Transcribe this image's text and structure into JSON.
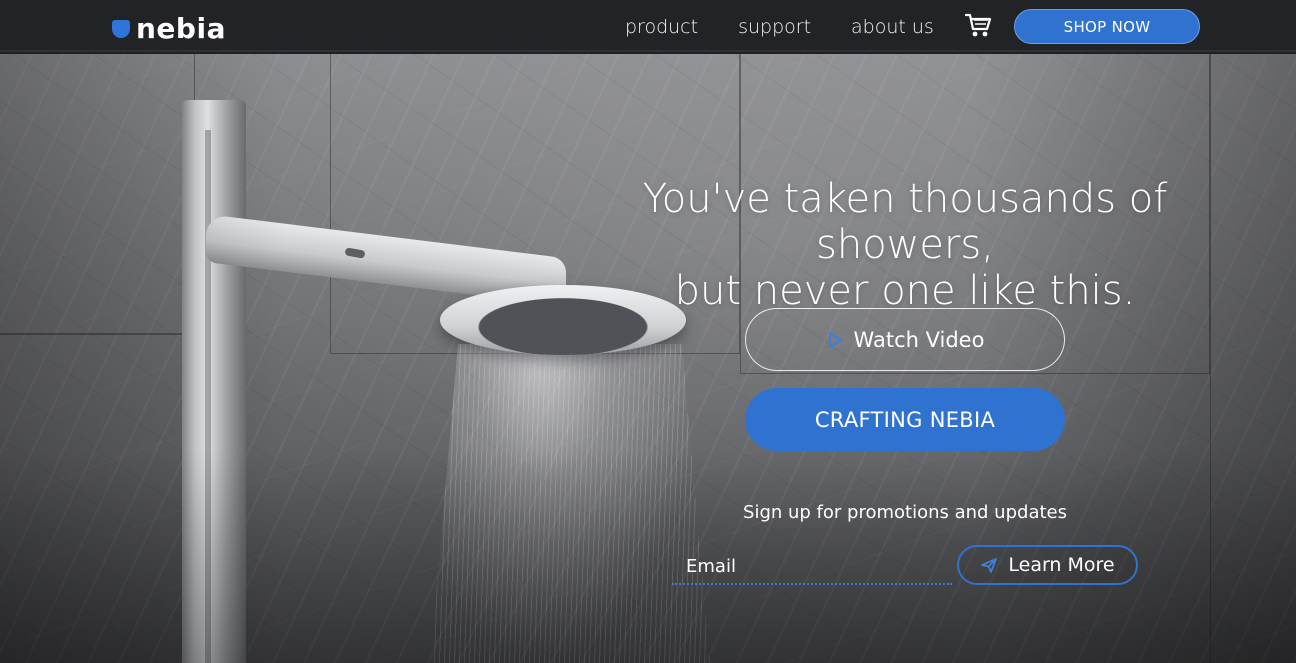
{
  "brand": {
    "name": "nebia",
    "accent": "#2f72cf"
  },
  "nav": {
    "items": [
      {
        "label": "product"
      },
      {
        "label": "support"
      },
      {
        "label": "about us"
      }
    ],
    "cart_icon": "cart-icon",
    "shop_label": "SHOP NOW"
  },
  "hero": {
    "headline_line1": "You've taken thousands of showers,",
    "headline_line2": "but never one like this.",
    "watch_video_label": "Watch Video",
    "play_icon": "play-icon",
    "crafting_label": "CRAFTING NEBIA",
    "signup_text": "Sign up for promotions and updates",
    "email_placeholder": "Email",
    "learn_more_label": "Learn More",
    "send_icon": "send-icon"
  }
}
